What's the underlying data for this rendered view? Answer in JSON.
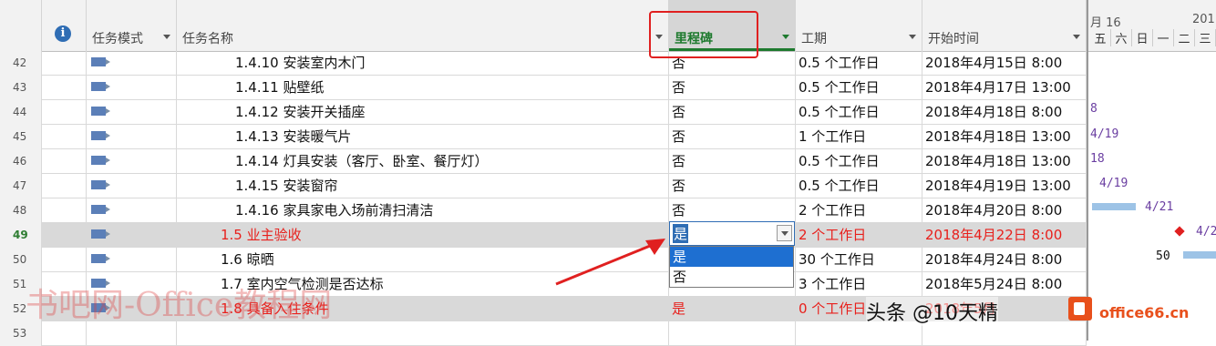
{
  "columns": {
    "info": "i",
    "mode": "任务模式",
    "name": "任务名称",
    "milestone": "里程碑",
    "duration": "工期",
    "start": "开始时间"
  },
  "gantt_header": {
    "month_left": "月 16",
    "month_right": "201",
    "days": [
      "五",
      "六",
      "日",
      "一",
      "二",
      "三"
    ]
  },
  "rows": [
    {
      "num": "42",
      "name": "1.4.10 安装室内木门",
      "milestone": "否",
      "duration": "0.5 个工作日",
      "start": "2018年4月15日 8:00"
    },
    {
      "num": "43",
      "name": "1.4.11 贴壁纸",
      "milestone": "否",
      "duration": "0.5 个工作日",
      "start": "2018年4月17日 13:00"
    },
    {
      "num": "44",
      "name": "1.4.12 安装开关插座",
      "milestone": "否",
      "duration": "0.5 个工作日",
      "start": "2018年4月18日 8:00"
    },
    {
      "num": "45",
      "name": "1.4.13 安装暖气片",
      "milestone": "否",
      "duration": "1 个工作日",
      "start": "2018年4月18日 13:00"
    },
    {
      "num": "46",
      "name": "1.4.14 灯具安装（客厅、卧室、餐厅灯）",
      "milestone": "否",
      "duration": "0.5 个工作日",
      "start": "2018年4月18日 13:00"
    },
    {
      "num": "47",
      "name": "1.4.15 安装窗帘",
      "milestone": "否",
      "duration": "0.5 个工作日",
      "start": "2018年4月19日 13:00"
    },
    {
      "num": "48",
      "name": "1.4.16 家具家电入场前清扫清洁",
      "milestone": "否",
      "duration": "2 个工作日",
      "start": "2018年4月20日 8:00"
    },
    {
      "num": "49",
      "name": "1.5 业主验收",
      "milestone": "是",
      "duration": "2 个工作日",
      "start": "2018年4月22日 8:00"
    },
    {
      "num": "50",
      "name": "1.6 晾晒",
      "milestone": "",
      "duration": "30 个工作日",
      "start": "2018年4月24日 8:00"
    },
    {
      "num": "51",
      "name": "1.7 室内空气检测是否达标",
      "milestone": "",
      "duration": "3 个工作日",
      "start": "2018年5月24日 8:00"
    },
    {
      "num": "52",
      "name": "1.8 具备入住条件",
      "milestone": "是",
      "duration": "0 个工作日",
      "start": "2018年5月"
    },
    {
      "num": "53",
      "name": "",
      "milestone": "",
      "duration": "",
      "start": ""
    }
  ],
  "dropdown": {
    "value": "是",
    "options": [
      "是",
      "否"
    ]
  },
  "gantt_labels": [
    "8",
    "4/19",
    "18",
    "4/19",
    "4/21",
    "4/2",
    "50"
  ],
  "watermarks": {
    "left": "书吧网-Office教程网",
    "right": "头条 @10天精",
    "logo": "office66.cn"
  }
}
